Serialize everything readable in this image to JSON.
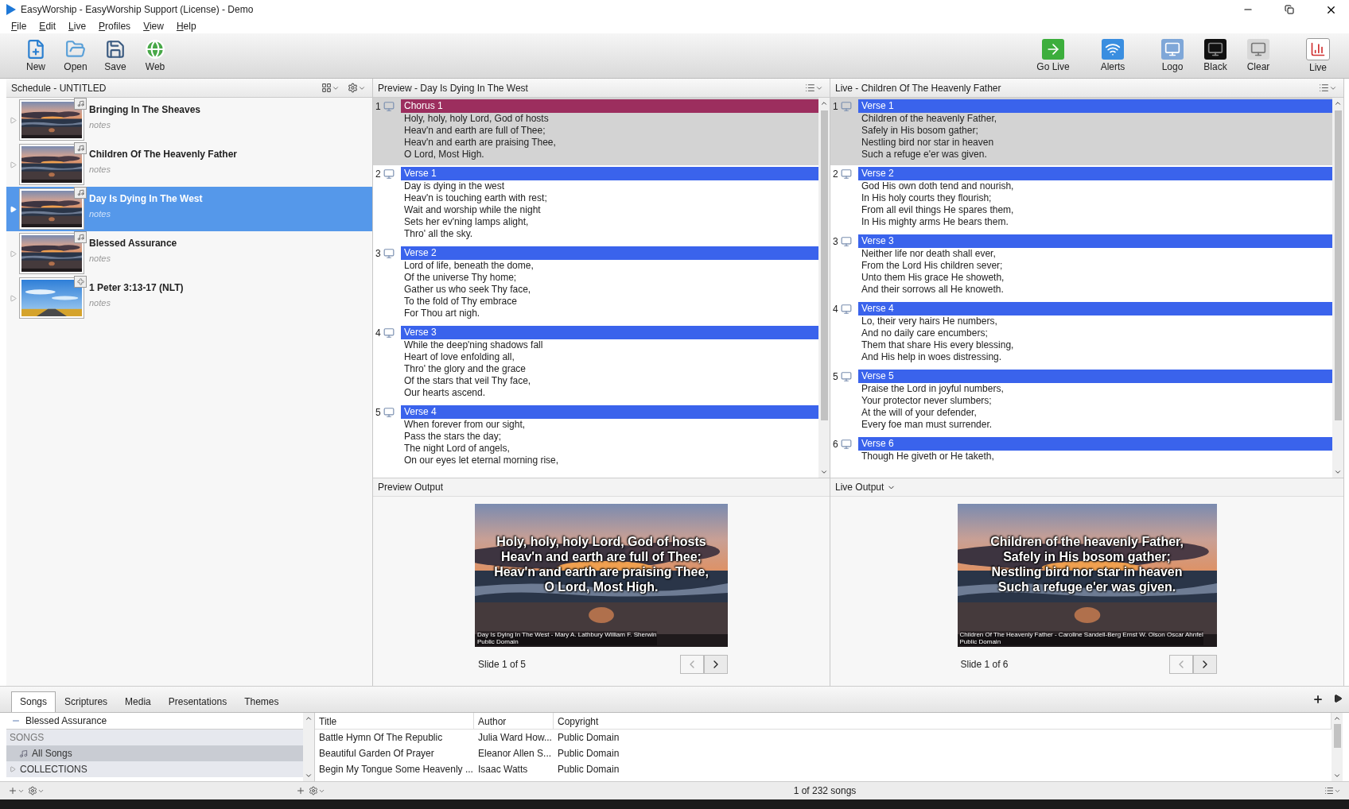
{
  "window": {
    "title": "EasyWorship - EasyWorship Support (License) - Demo"
  },
  "menu": [
    "File",
    "Edit",
    "Live",
    "Profiles",
    "View",
    "Help"
  ],
  "toolbar": {
    "left": [
      {
        "label": "New",
        "kind": "new"
      },
      {
        "label": "Open",
        "kind": "open"
      },
      {
        "label": "Save",
        "kind": "save"
      },
      {
        "label": "Web",
        "kind": "web"
      }
    ],
    "right": [
      {
        "label": "Go Live",
        "kind": "golive"
      },
      {
        "label": "Alerts",
        "kind": "alerts"
      },
      {
        "label": "Logo",
        "kind": "logo"
      },
      {
        "label": "Black",
        "kind": "black"
      },
      {
        "label": "Clear",
        "kind": "clear"
      },
      {
        "label": "Live",
        "kind": "live"
      }
    ]
  },
  "schedule": {
    "title": "Schedule - UNTITLED",
    "items": [
      {
        "title": "Bringing In The Sheaves",
        "notes": "notes",
        "kind": "song",
        "selected": false
      },
      {
        "title": "Children Of The Heavenly Father",
        "notes": "notes",
        "kind": "song",
        "selected": false
      },
      {
        "title": "Day Is Dying In The West",
        "notes": "notes",
        "kind": "song",
        "selected": true
      },
      {
        "title": "Blessed Assurance",
        "notes": "notes",
        "kind": "song",
        "selected": false
      },
      {
        "title": "1 Peter 3:13-17 (NLT)",
        "notes": "notes",
        "kind": "scripture",
        "selected": false
      }
    ]
  },
  "preview": {
    "title": "Preview - Day Is Dying In The West",
    "slides": [
      {
        "number": "1",
        "label": "Chorus 1",
        "color": "#9c2e5e",
        "selected": true,
        "lines": [
          "Holy, holy, holy Lord, God of hosts",
          "Heav'n and earth are full of Thee;",
          "Heav'n and earth are praising Thee,",
          "O Lord, Most High."
        ]
      },
      {
        "number": "2",
        "label": "Verse 1",
        "color": "#3a63ec",
        "selected": false,
        "lines": [
          "Day is dying in the west",
          "Heav'n is touching earth with rest;",
          "Wait and worship while the night",
          "Sets her ev'ning lamps alight,",
          "Thro' all the sky."
        ]
      },
      {
        "number": "3",
        "label": "Verse 2",
        "color": "#3a63ec",
        "selected": false,
        "lines": [
          "Lord of life, beneath the dome,",
          "Of the universe Thy home;",
          "Gather us who seek Thy face,",
          "To the fold of Thy embrace",
          "For Thou art nigh."
        ]
      },
      {
        "number": "4",
        "label": "Verse 3",
        "color": "#3a63ec",
        "selected": false,
        "lines": [
          "While the deep'ning shadows fall",
          "Heart of love enfolding all,",
          "Thro' the glory and the grace",
          "Of the stars that veil Thy face,",
          "Our hearts ascend."
        ]
      },
      {
        "number": "5",
        "label": "Verse 4",
        "color": "#3a63ec",
        "selected": false,
        "lines": [
          "When forever from our sight,",
          "Pass the stars the day;",
          "The night Lord of angels,",
          "On our eyes let eternal morning rise,"
        ]
      }
    ]
  },
  "live": {
    "title": "Live - Children Of The Heavenly Father",
    "slides": [
      {
        "number": "1",
        "label": "Verse 1",
        "color": "#3a63ec",
        "selected": true,
        "lines": [
          "Children of the heavenly Father,",
          "Safely in His bosom gather;",
          "Nestling bird nor star in heaven",
          "Such a refuge e'er was given."
        ]
      },
      {
        "number": "2",
        "label": "Verse 2",
        "color": "#3a63ec",
        "selected": false,
        "lines": [
          "God His own doth tend and nourish,",
          "In His holy courts they flourish;",
          "From all evil things He spares them,",
          "In His mighty arms He bears them."
        ]
      },
      {
        "number": "3",
        "label": "Verse 3",
        "color": "#3a63ec",
        "selected": false,
        "lines": [
          "Neither life nor death shall ever,",
          "From the Lord His children sever;",
          "Unto them His grace He showeth,",
          "And their sorrows all He knoweth."
        ]
      },
      {
        "number": "4",
        "label": "Verse 4",
        "color": "#3a63ec",
        "selected": false,
        "lines": [
          "Lo, their very hairs He numbers,",
          "And no daily care encumbers;",
          "Them that share His every blessing,",
          "And His help in woes distressing."
        ]
      },
      {
        "number": "5",
        "label": "Verse 5",
        "color": "#3a63ec",
        "selected": false,
        "lines": [
          "Praise the Lord in joyful numbers,",
          "Your protector never slumbers;",
          "At the will of your defender,",
          "Every foe man must surrender."
        ]
      },
      {
        "number": "6",
        "label": "Verse 6",
        "color": "#3a63ec",
        "selected": false,
        "lines": [
          "Though He giveth or He taketh,"
        ]
      }
    ]
  },
  "preview_output": {
    "title": "Preview Output",
    "menu": false,
    "lines": [
      "Holy, holy, holy Lord, God of hosts",
      "Heav'n and earth are full of Thee;",
      "Heav'n and earth are praising Thee,",
      "O Lord, Most High."
    ],
    "credit": [
      "Day Is Dying In The West - Mary A. Lathbury William F. Sherwin",
      "Public Domain"
    ],
    "counter": "Slide 1 of 5"
  },
  "live_output": {
    "title": "Live Output",
    "menu": true,
    "lines": [
      "Children of the heavenly Father,",
      "Safely in His bosom gather;",
      "Nestling bird nor star in heaven",
      "Such a refuge e'er was given."
    ],
    "credit": [
      "Children Of The Heavenly Father - Caroline Sandell-Berg Ernst W. Olson Oscar Ahnfel",
      "Public Domain"
    ],
    "counter": "Slide 1 of 6"
  },
  "library": {
    "tabs": [
      {
        "label": "Songs",
        "selected": true
      },
      {
        "label": "Scriptures",
        "selected": false
      },
      {
        "label": "Media",
        "selected": false
      },
      {
        "label": "Presentations",
        "selected": false
      },
      {
        "label": "Themes",
        "selected": false
      }
    ],
    "current": "Blessed Assurance",
    "tree": [
      {
        "label": "SONGS",
        "kind": "heading",
        "selected": false
      },
      {
        "label": "All Songs",
        "kind": "item",
        "selected": true
      },
      {
        "label": "COLLECTIONS",
        "kind": "group",
        "selected": false,
        "expanded": false
      }
    ],
    "table": {
      "columns": [
        "Title",
        "Author",
        "Copyright"
      ],
      "rows": [
        [
          "Battle Hymn Of The Republic",
          "Julia Ward How...",
          "Public Domain"
        ],
        [
          "Beautiful Garden Of Prayer",
          "Eleanor Allen S...",
          "Public Domain"
        ],
        [
          "Begin My Tongue Some Heavenly ...",
          "Isaac Watts",
          "Public Domain"
        ]
      ]
    },
    "status": "1 of 232 songs"
  }
}
